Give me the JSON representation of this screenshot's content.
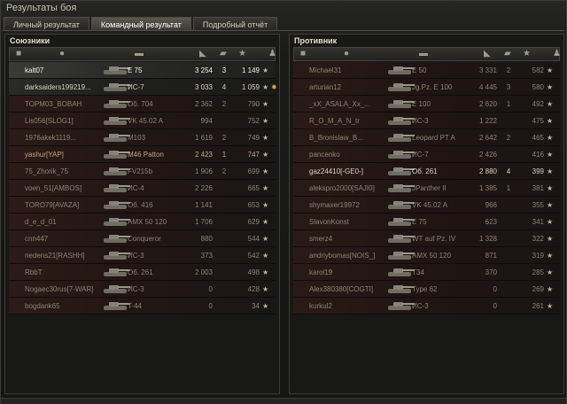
{
  "title": "Результаты боя",
  "tabs": [
    "Личный результат",
    "Командный результат",
    "Подробный отчёт"
  ],
  "allies_title": "Союзники",
  "enemies_title": "Противник",
  "icons": {
    "col_vehicle": "vehicle-type-icon",
    "col_player": "player-icon",
    "col_damage": "damage-icon",
    "col_kills": "kills-tank-icon",
    "col_xp": "star-icon",
    "col_status": "status-icon"
  },
  "allies": [
    {
      "player": "kalt07",
      "tank": "E 75",
      "damage": "3 254",
      "frags": "3",
      "xp": "1 149",
      "state": "alive"
    },
    {
      "player": "darksaiders199219...",
      "tank": "ИС-7",
      "damage": "3 033",
      "frags": "4",
      "xp": "1 059",
      "state": "alive",
      "medal": "medal-icon"
    },
    {
      "player": "TOPM03_BOBAH",
      "tank": "Об. 704",
      "damage": "2 362",
      "frags": "2",
      "xp": "790",
      "state": "dead"
    },
    {
      "player": "Lis056[SLOG1]",
      "tank": "VK 45.02 A",
      "damage": "994",
      "frags": "",
      "xp": "752",
      "state": "dead"
    },
    {
      "player": "1976akek1119...",
      "tank": "M103",
      "damage": "1 619",
      "frags": "2",
      "xp": "749",
      "state": "dead"
    },
    {
      "player": "yashur[YAP]",
      "tank": "M46 Patton",
      "damage": "2 423",
      "frags": "1",
      "xp": "747",
      "state": "platoon"
    },
    {
      "player": "75_Zhorik_75",
      "tank": "FV215b",
      "damage": "1 906",
      "frags": "2",
      "xp": "699",
      "state": "dead"
    },
    {
      "player": "voen_51[AMBOS]",
      "tank": "ИС-4",
      "damage": "2 226",
      "frags": "",
      "xp": "665",
      "state": "dead"
    },
    {
      "player": "TORO79[AVAZA]",
      "tank": "Об. 416",
      "damage": "1 141",
      "frags": "",
      "xp": "653",
      "state": "dead"
    },
    {
      "player": "d_e_d_01",
      "tank": "AMX 50 120",
      "damage": "1 706",
      "frags": "",
      "xp": "629",
      "state": "dead"
    },
    {
      "player": "cnn447",
      "tank": "Conqueror",
      "damage": "880",
      "frags": "",
      "xp": "544",
      "state": "dead"
    },
    {
      "player": "nedens21[RASHH]",
      "tank": "ИС-3",
      "damage": "373",
      "frags": "",
      "xp": "542",
      "state": "dead"
    },
    {
      "player": "RbbT",
      "tank": "Об. 261",
      "damage": "2 003",
      "frags": "",
      "xp": "498",
      "state": "dead"
    },
    {
      "player": "Nogaec30rus[7-WAR]",
      "tank": "ИС-3",
      "damage": "0",
      "frags": "",
      "xp": "428",
      "state": "dead"
    },
    {
      "player": "bogdank65",
      "tank": "T-44",
      "damage": "0",
      "frags": "",
      "xp": "34",
      "state": "dead"
    }
  ],
  "enemies": [
    {
      "player": "Michael31",
      "tank": "E 50",
      "damage": "3 331",
      "frags": "2",
      "xp": "582",
      "state": "dead"
    },
    {
      "player": "arturian12",
      "tank": "Jg.Pz. E 100",
      "damage": "4 445",
      "frags": "3",
      "xp": "580",
      "state": "dead"
    },
    {
      "player": "_xX_ASALA_Xx_...",
      "tank": "E 100",
      "damage": "2 620",
      "frags": "1",
      "xp": "492",
      "state": "dead"
    },
    {
      "player": "R_O_M_A_N_tr",
      "tank": "ИС-3",
      "damage": "1 222",
      "frags": "",
      "xp": "475",
      "state": "dead"
    },
    {
      "player": "B_Bronislaw_B...",
      "tank": "Leopard PT A",
      "damage": "2 642",
      "frags": "2",
      "xp": "465",
      "state": "dead"
    },
    {
      "player": "pancenko",
      "tank": "ИС-7",
      "damage": "2 426",
      "frags": "",
      "xp": "416",
      "state": "dead"
    },
    {
      "player": "gaz24410[-GE0-]",
      "tank": "Об. 261",
      "damage": "2 880",
      "frags": "4",
      "xp": "399",
      "state": "alive"
    },
    {
      "player": "alekspro2000[SAJI0]",
      "tank": "JPanther II",
      "damage": "1 385",
      "frags": "1",
      "xp": "381",
      "state": "dead"
    },
    {
      "player": "shymaxer19972",
      "tank": "VK 45.02 A",
      "damage": "966",
      "frags": "",
      "xp": "355",
      "state": "dead"
    },
    {
      "player": "SlavonKonst",
      "tank": "E 75",
      "damage": "623",
      "frags": "",
      "xp": "341",
      "state": "dead"
    },
    {
      "player": "smerz4",
      "tank": "WT auf Pz. IV",
      "damage": "1 328",
      "frags": "",
      "xp": "322",
      "state": "dead"
    },
    {
      "player": "andriybomas[NOIS_]",
      "tank": "AMX 50 120",
      "damage": "871",
      "frags": "",
      "xp": "319",
      "state": "dead"
    },
    {
      "player": "karol19",
      "tank": "T34",
      "damage": "370",
      "frags": "",
      "xp": "285",
      "state": "dead"
    },
    {
      "player": "Alex380380[COGTI]",
      "tank": "Type 62",
      "damage": "0",
      "frags": "",
      "xp": "269",
      "state": "dead"
    },
    {
      "player": "kurkul2",
      "tank": "ИС-3",
      "damage": "0",
      "frags": "",
      "xp": "261",
      "state": "dead"
    }
  ]
}
